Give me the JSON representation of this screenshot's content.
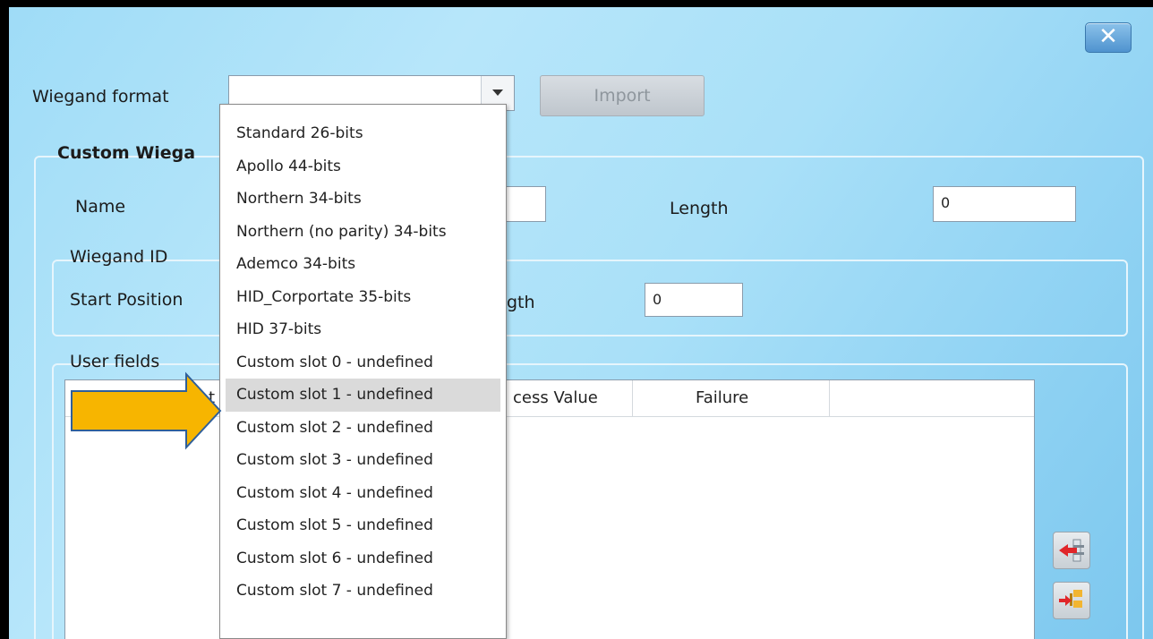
{
  "dialog": {
    "close_glyph": "✕"
  },
  "wiegand_format": {
    "label": "Wiegand format",
    "value": "",
    "import_label": "Import"
  },
  "custom_group": {
    "title": "Custom Wiega",
    "name_label": "Name",
    "length_label": "Length",
    "length_value": "0"
  },
  "wiegand_id": {
    "title": "Wiegand ID",
    "start_label": "Start Position",
    "length_label": "gth",
    "length_value": "0"
  },
  "user_fields": {
    "title": "User fields",
    "columns": [
      "t",
      "cess Value",
      "Failure"
    ]
  },
  "dropdown": {
    "items": [
      "Standard 26-bits",
      "Apollo 44-bits",
      "Northern 34-bits",
      "Northern (no parity) 34-bits",
      "Ademco 34-bits",
      "HID_Corportate 35-bits",
      "HID 37-bits",
      "Custom slot 0 - undefined",
      "Custom slot 1 - undefined",
      "Custom slot 2 - undefined",
      "Custom slot 3 - undefined",
      "Custom slot 4 - undefined",
      "Custom slot 5 - undefined",
      "Custom slot 6 - undefined",
      "Custom slot 7 - undefined"
    ],
    "highlighted_index": 8
  },
  "colors": {
    "accent_arrow": "#f7b500",
    "arrow_stroke": "#2f5f9a",
    "highlight": "#dadada"
  },
  "icons": {
    "side_button_1": "move-left-arrow-icon",
    "side_button_2": "move-right-tree-icon"
  }
}
